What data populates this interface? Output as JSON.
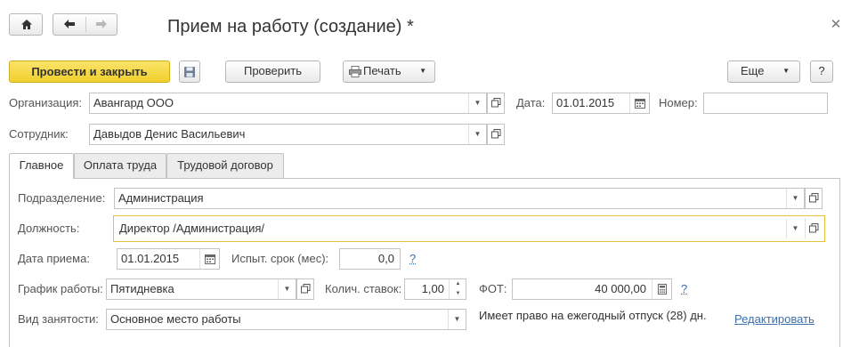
{
  "header": {
    "title": "Прием на работу (создание) *"
  },
  "toolbar": {
    "post_close_label": "Провести и закрыть",
    "check_label": "Проверить",
    "print_label": "Печать",
    "more_label": "Еще",
    "help_label": "?"
  },
  "form": {
    "organization_label": "Организация:",
    "organization_value": "Авангард ООО",
    "date_label": "Дата:",
    "date_value": "01.01.2015",
    "number_label": "Номер:",
    "number_value": "",
    "employee_label": "Сотрудник:",
    "employee_value": "Давыдов Денис Васильевич"
  },
  "tabs": [
    {
      "label": "Главное"
    },
    {
      "label": "Оплата труда"
    },
    {
      "label": "Трудовой договор"
    }
  ],
  "main": {
    "department_label": "Подразделение:",
    "department_value": "Администрация",
    "position_label": "Должность:",
    "position_value": "Директор /Администрация/",
    "hire_date_label": "Дата приема:",
    "hire_date_value": "01.01.2015",
    "probation_label": "Испыт. срок (мес):",
    "probation_value": "0,0",
    "schedule_label": "График работы:",
    "schedule_value": "Пятидневка",
    "rates_label": "Колич. ставок:",
    "rates_value": "1,00",
    "fot_label": "ФОТ:",
    "fot_value": "40 000,00",
    "employment_label": "Вид занятости:",
    "employment_value": "Основное место работы",
    "vacation_text": "Имеет право на ежегодный отпуск (28) дн.",
    "edit_link": "Редактировать",
    "help_mark": "?"
  },
  "colors": {
    "primary_button": "#f5d93f",
    "focus_border": "#e6c23a",
    "link": "#3d6ea8"
  }
}
